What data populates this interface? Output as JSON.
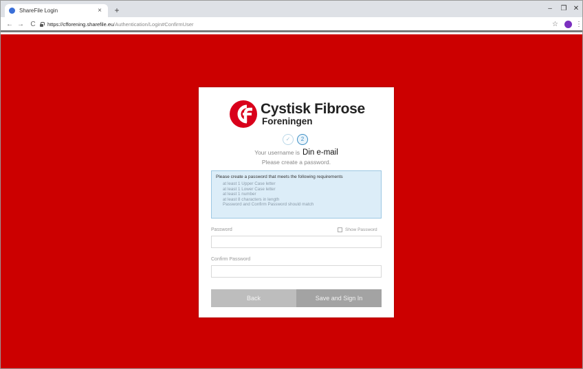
{
  "browser": {
    "tab": {
      "title": "ShareFile Login",
      "close": "×"
    },
    "new_tab": "+",
    "window_controls": {
      "minimize": "–",
      "restore": "❐",
      "close": "✕"
    },
    "nav": {
      "back": "←",
      "forward": "→",
      "reload": "C"
    },
    "address": {
      "host": "https://cfforening.sharefile.eu",
      "path": "/Authentication/Login#ConfirmUser"
    },
    "bookmark_icon": "☆",
    "profile_initial": "",
    "menu_icon": "⋮"
  },
  "colors": {
    "page_background": "#cc0000",
    "logo_red": "#d9001b",
    "accent_blue": "#3a8dc4"
  },
  "logo": {
    "mark": "cf",
    "title": "Cystisk Fibrose",
    "subtitle": "Foreningen"
  },
  "steps": {
    "done_symbol": "✓",
    "active_number": "2"
  },
  "username": {
    "label": "Your username is",
    "value": "Din e-mail"
  },
  "instruction": "Please create a password.",
  "requirements": {
    "title": "Please create a password that meets the following requirements",
    "items": [
      "at least 1 Upper Case letter",
      "at least 1 Lower Case letter",
      "at least 1 number",
      "at least 8 characters in length",
      "Password and Confirm Password should match"
    ]
  },
  "form": {
    "password_label": "Password",
    "show_password_label": "Show Password",
    "password_value": "",
    "confirm_label": "Confirm Password",
    "confirm_value": ""
  },
  "buttons": {
    "back": "Back",
    "save": "Save and Sign In"
  }
}
